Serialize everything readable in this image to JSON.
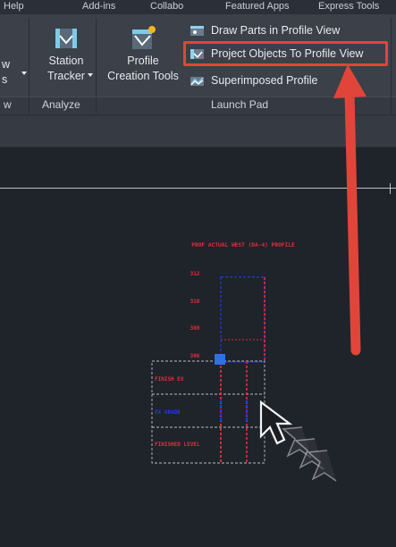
{
  "menu_partial": [
    "Help",
    "Add-ins",
    "Collabo",
    "Featured Apps",
    "Express Tools"
  ],
  "ribbon": {
    "left_partial_labels": [
      "w",
      "s",
      "w"
    ],
    "analyze_group": {
      "label": "Analyze",
      "station_tracker": {
        "line1": "Station",
        "line2": "Tracker"
      }
    },
    "launch_pad_group": {
      "label": "Launch Pad",
      "profile_creation_tools": {
        "line1": "Profile",
        "line2": "Creation Tools"
      },
      "items": [
        {
          "label": "Draw Parts in Profile View",
          "icon": "draw-parts-icon"
        },
        {
          "label": "Project Objects To Profile View",
          "icon": "project-objects-icon"
        },
        {
          "label": "Superimposed Profile",
          "icon": "superimposed-profile-icon"
        }
      ]
    }
  },
  "annotation": {
    "arrow_color": "#e1453a",
    "highlight_color": "#e1453a"
  },
  "drawing": {
    "title": "PROF ACTUAL WEST (DA-4) PROFILE",
    "elevations": [
      "312",
      "310",
      "308",
      "306"
    ],
    "row_labels": [
      "FINISH EX",
      "EX GRADE",
      "FINISHED LEVEL"
    ],
    "colors": {
      "red": "#e0303a",
      "blue": "#2338e8",
      "grid": "#b8bcc2",
      "grip": "#2f6fe8"
    }
  }
}
